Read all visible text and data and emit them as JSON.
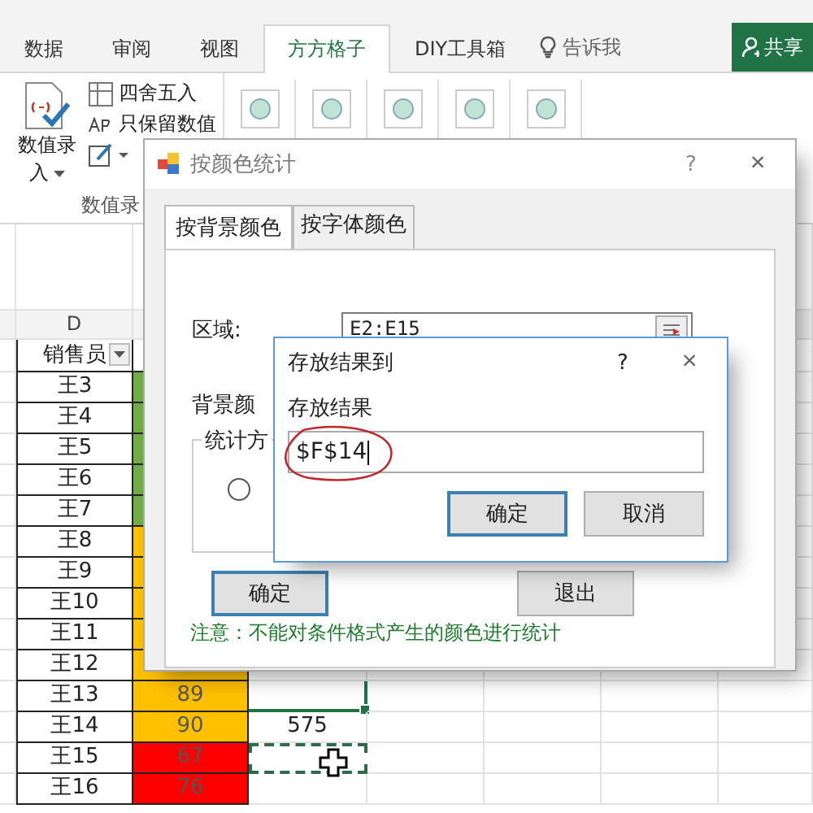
{
  "ribbon": {
    "tabs": [
      {
        "label": "数据",
        "selected": false
      },
      {
        "label": "审阅",
        "selected": false
      },
      {
        "label": "视图",
        "selected": false
      },
      {
        "label": "方方格子",
        "selected": true
      },
      {
        "label": "DIY工具箱",
        "selected": false
      }
    ],
    "tell_me": "告诉我",
    "share": "共享",
    "big_button": {
      "line_1": "数值录",
      "line_2": "入"
    },
    "small_buttons": [
      "四舍五入",
      "只保留数值"
    ],
    "group_label": "数值录"
  },
  "sheet": {
    "column_header": "D",
    "header_cell": "销售员",
    "rows": [
      {
        "name": "王3",
        "color": "#70ad47"
      },
      {
        "name": "王4",
        "color": "#70ad47"
      },
      {
        "name": "王5",
        "color": "#70ad47"
      },
      {
        "name": "王6",
        "color": "#70ad47"
      },
      {
        "name": "王7",
        "color": "#70ad47"
      },
      {
        "name": "王8",
        "color": "#ffc000"
      },
      {
        "name": "王9",
        "color": "#ffc000"
      },
      {
        "name": "王10",
        "color": "#ffc000"
      },
      {
        "name": "王11",
        "color": "#ffc000"
      },
      {
        "name": "王12",
        "color": "#ffc000"
      },
      {
        "name": "王13",
        "score": "89",
        "color": "#ffc000"
      },
      {
        "name": "王14",
        "score": "90",
        "color": "#ffc000",
        "result": "575"
      },
      {
        "name": "王15",
        "score": "67",
        "color": "#ff0000"
      },
      {
        "name": "王16",
        "score": "76",
        "color": "#ff0000"
      }
    ]
  },
  "dialog": {
    "title": "按颜色统计",
    "help": "?",
    "close": "×",
    "tabs": [
      {
        "label": "按背景颜色",
        "selected": true
      },
      {
        "label": "按字体颜色",
        "selected": false
      }
    ],
    "range_label": "区域:",
    "range_value": "E2:E15",
    "color_label": "背景颜",
    "method_label": "统计方",
    "radio": {
      "selected": false
    },
    "buttons": [
      {
        "label": "确定",
        "focused": true
      },
      {
        "label": "退出",
        "focused": false
      }
    ],
    "note": "注意：不能对条件格式产生的颜色进行统计"
  },
  "result_dialog": {
    "title": "存放结果到",
    "help": "?",
    "close": "×",
    "field_label": "存放结果",
    "value": "$F$14",
    "buttons": [
      {
        "label": "确定",
        "focused": true
      },
      {
        "label": "取消",
        "focused": false
      }
    ]
  }
}
